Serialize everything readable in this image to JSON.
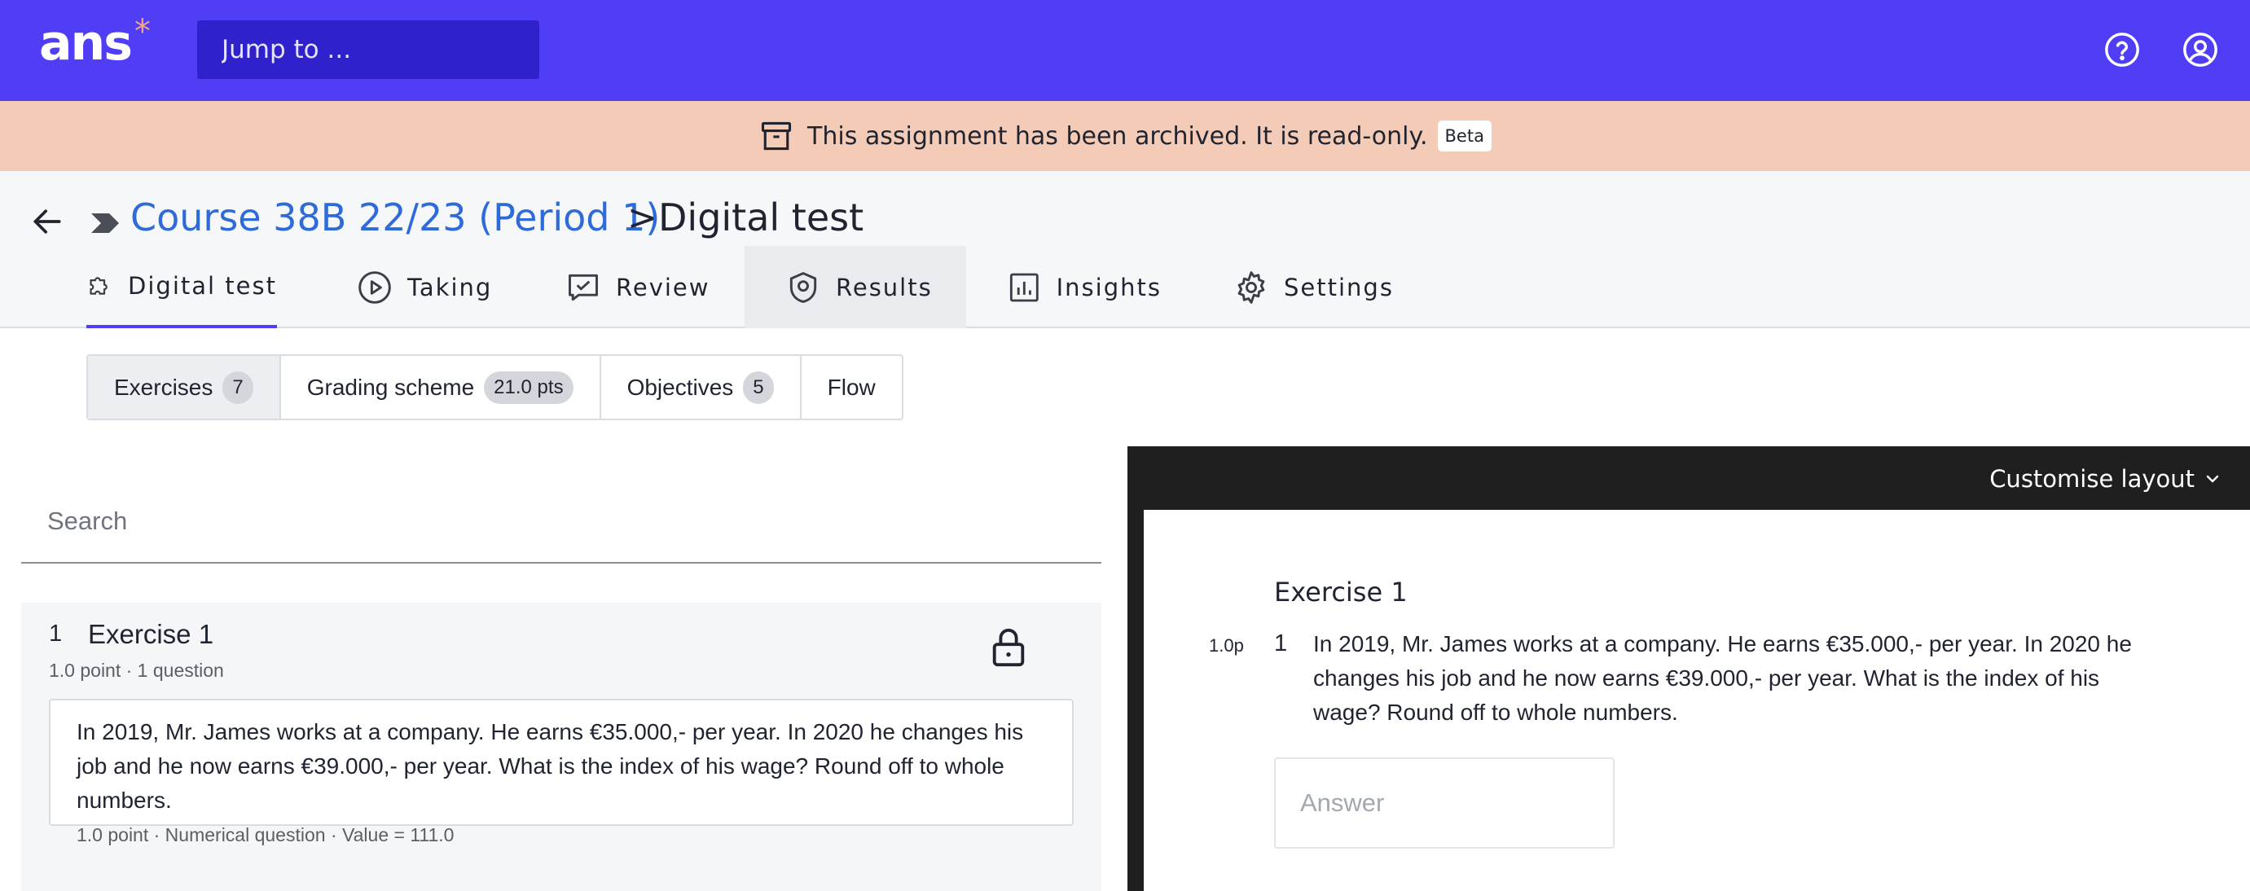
{
  "topbar": {
    "logo_text": "ans",
    "logo_mark": "*",
    "jump_placeholder": "Jump to ...",
    "help_icon": "help-circle-icon",
    "account_icon": "user-circle-icon",
    "color": "#503ef7"
  },
  "banner": {
    "text": "This assignment has been archived. It is read-only.",
    "badge": "Beta",
    "icon": "archive-box-icon",
    "color": "#f4cbb6"
  },
  "breadcrumb": {
    "course": "Course 38B 22/23 (Period 1)",
    "separator": ">",
    "current": "Digital test"
  },
  "tabs": [
    {
      "label": "Digital test",
      "icon": "puzzle-icon",
      "active": true
    },
    {
      "label": "Taking",
      "icon": "play-circle-icon"
    },
    {
      "label": "Review",
      "icon": "chat-check-icon"
    },
    {
      "label": "Results",
      "icon": "shield-icon"
    },
    {
      "label": "Insights",
      "icon": "bar-chart-icon"
    },
    {
      "label": "Settings",
      "icon": "gear-icon"
    }
  ],
  "subtabs": [
    {
      "label": "Exercises",
      "count": "7",
      "selected": true
    },
    {
      "label": "Grading scheme",
      "count": "21.0 pts"
    },
    {
      "label": "Objectives",
      "count": "5"
    },
    {
      "label": "Flow",
      "count": ""
    }
  ],
  "search": {
    "placeholder": "Search"
  },
  "exercise": {
    "number": "1",
    "title": "Exercise 1",
    "meta": "1.0 point · 1 question",
    "question_text": "In 2019, Mr. James works at a company. He earns €35.000,- per year. In 2020 he changes his job and he now earns €39.000,- per year. What is the index of his wage? Round off to whole numbers.",
    "question_meta": "1.0 point · Numerical question · Value = 111.0"
  },
  "preview": {
    "customise_label": "Customise layout",
    "title": "Exercise 1",
    "points": "1.0p",
    "question_number": "1",
    "question_text": "In 2019, Mr. James works at a company. He earns €35.000,- per year. In 2020 he changes his job and he now earns €39.000,- per year. What is the index of his wage? Round off to whole numbers.",
    "answer_placeholder": "Answer"
  }
}
